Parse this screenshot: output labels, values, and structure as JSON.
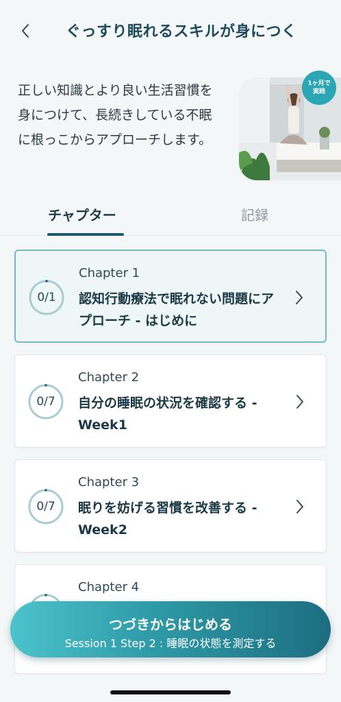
{
  "header": {
    "back_icon": "chevron-left-icon",
    "title": "ぐっすり眠れるスキルが身につく"
  },
  "intro": {
    "text": "正しい知識とより良い生活習慣を身につけて、長続きしている不眠に根っこからアプローチします。",
    "badge_line1": "1ヶ月で",
    "badge_line2": "実践"
  },
  "tabs": {
    "active": "チャプター",
    "inactive": "記録"
  },
  "chapters": [
    {
      "number": "Chapter 1",
      "title": "認知行動療法で眠れない問題にアプローチ - はじめに",
      "progress": "0/1"
    },
    {
      "number": "Chapter 2",
      "title": "自分の睡眠の状況を確認する - Week1",
      "progress": "0/7"
    },
    {
      "number": "Chapter 3",
      "title": "眠りを妨げる習慣を改善する - Week2",
      "progress": "0/7"
    },
    {
      "number": "Chapter 4",
      "title": "",
      "progress": ""
    }
  ],
  "cta": {
    "label": "つづきからはじめる",
    "sub": "Session 1 Step 2 : 睡眠の状態を測定する"
  },
  "colors": {
    "accent": "#1e5a6a",
    "teal": "#2aa6b4",
    "ring": "#a7ccd3"
  }
}
